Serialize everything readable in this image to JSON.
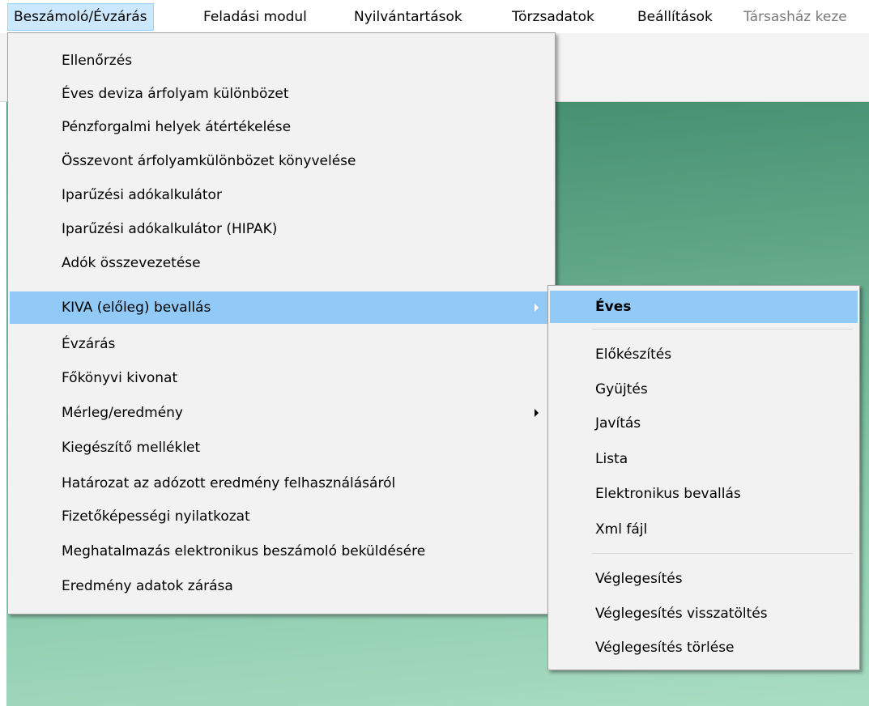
{
  "menubar": {
    "items": [
      {
        "label": "Beszámoló/Évzárás"
      },
      {
        "label": "Feladási modul"
      },
      {
        "label": "Nyilvántartások"
      },
      {
        "label": "Törzsadatok"
      },
      {
        "label": "Beállítások"
      },
      {
        "label": "Társasház keze"
      }
    ]
  },
  "main_menu": {
    "items": [
      {
        "label": "Ellenőrzés"
      },
      {
        "label": "Éves deviza árfolyam különbözet"
      },
      {
        "label": "Pénzforgalmi helyek átértékelése"
      },
      {
        "label": "Összevont árfolyamkülönbözet könyvelése"
      },
      {
        "label": "Iparűzési adókalkulátor"
      },
      {
        "label": "Iparűzési adókalkulátor (HIPAK)"
      },
      {
        "label": "Adók összevezetése"
      },
      {
        "label": "KIVA (előleg) bevallás"
      },
      {
        "label": "Évzárás"
      },
      {
        "label": "Főkönyvi kivonat"
      },
      {
        "label": "Mérleg/eredmény"
      },
      {
        "label": "Kiegészítő melléklet"
      },
      {
        "label": "Határozat az adózott eredmény  felhasználásáról"
      },
      {
        "label": "Fizetőképességi nyilatkozat"
      },
      {
        "label": "Meghatalmazás elektronikus beszámoló beküldésére"
      },
      {
        "label": "Eredmény adatok zárása"
      }
    ]
  },
  "sub_menu": {
    "items": [
      {
        "label": "Éves"
      },
      {
        "label": "Előkészítés"
      },
      {
        "label": "Gyüjtés"
      },
      {
        "label": "Javítás"
      },
      {
        "label": "Lista"
      },
      {
        "label": "Elektronikus bevallás"
      },
      {
        "label": "Xml fájl"
      },
      {
        "label": "Véglegesítés"
      },
      {
        "label": "Véglegesítés visszatöltés"
      },
      {
        "label": "Véglegesítés törlése"
      }
    ]
  },
  "colors": {
    "menu_highlight": "#91c9f7",
    "menubar_active": "#cce8ff",
    "menu_background": "#f2f2f2",
    "background_gradient_dark": "#3f8a6b",
    "background_gradient_light": "#a9ddc3"
  }
}
